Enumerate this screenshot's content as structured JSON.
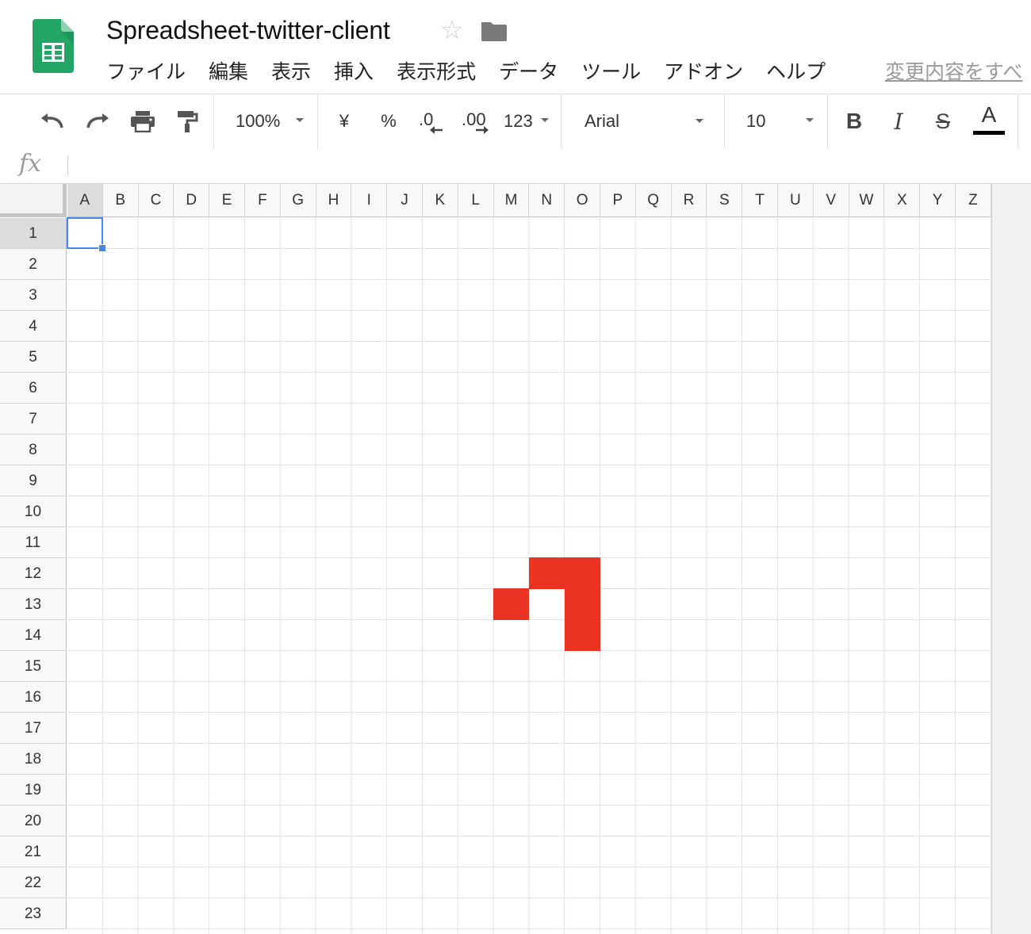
{
  "app": {
    "doc_title": "Spreadsheet-twitter-client",
    "logo_icon": "google-sheets-icon",
    "star_icon": "star-outline-icon",
    "folder_icon": "folder-icon"
  },
  "menu": {
    "items": [
      "ファイル",
      "編集",
      "表示",
      "挿入",
      "表示形式",
      "データ",
      "ツール",
      "アドオン",
      "ヘルプ"
    ],
    "changes_link": "変更内容をすべ"
  },
  "toolbar": {
    "undo_icon": "undo-icon",
    "redo_icon": "redo-icon",
    "print_icon": "print-icon",
    "paint_format_icon": "paint-format-icon",
    "zoom": "100%",
    "currency": "¥",
    "percent": "%",
    "decrease_decimal": ".0",
    "increase_decimal": ".00",
    "more_formats": "123",
    "font": "Arial",
    "font_size": "10",
    "bold": "B",
    "italic": "I",
    "strikethrough": "S",
    "text_color": "A",
    "text_color_value": "#000000"
  },
  "formula_bar": {
    "label": "fx",
    "value": ""
  },
  "grid": {
    "columns": [
      "A",
      "B",
      "C",
      "D",
      "E",
      "F",
      "G",
      "H",
      "I",
      "J",
      "K",
      "L",
      "M",
      "N",
      "O",
      "P",
      "Q",
      "R",
      "S",
      "T",
      "U",
      "V",
      "W",
      "X",
      "Y",
      "Z"
    ],
    "rows": [
      "1",
      "2",
      "3",
      "4",
      "5",
      "6",
      "7",
      "8",
      "9",
      "10",
      "11",
      "12",
      "13",
      "14",
      "15",
      "16",
      "17",
      "18",
      "19",
      "20",
      "21",
      "22",
      "23"
    ],
    "selected_cell": "A1",
    "fill_color": "#ea3323",
    "filled_cells": [
      "N12",
      "O12",
      "M13",
      "O13",
      "O14"
    ]
  }
}
